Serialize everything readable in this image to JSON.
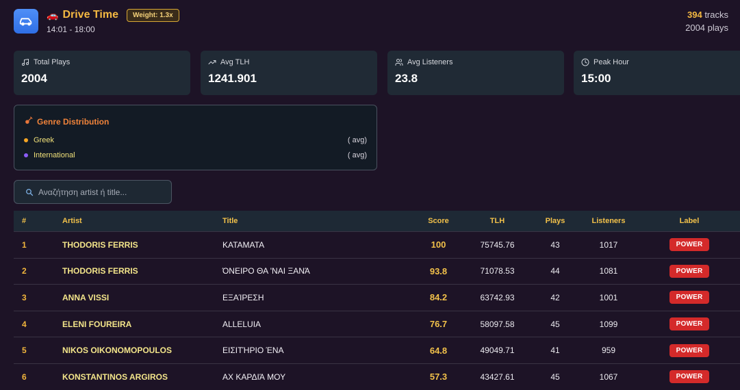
{
  "header": {
    "title": "Drive Time",
    "title_emoji": "🚗",
    "weight": "Weight: 1.3x",
    "time_range": "14:01 - 18:00",
    "tracks_number": "394",
    "tracks_suffix": " tracks",
    "plays": "2004 plays"
  },
  "stats": [
    {
      "label": "Total Plays",
      "value": "2004",
      "icon": "music-note-icon"
    },
    {
      "label": "Avg TLH",
      "value": "1241.901",
      "icon": "trending-up-icon"
    },
    {
      "label": "Avg Listeners",
      "value": "23.8",
      "icon": "users-icon"
    },
    {
      "label": "Peak Hour",
      "value": "15:00",
      "icon": "clock-icon"
    }
  ],
  "genre": {
    "title": "Genre Distribution",
    "icon": "guitar-icon",
    "items": [
      {
        "name": "Greek",
        "avg": "( avg)",
        "color": "#f5a524"
      },
      {
        "name": "International",
        "avg": "( avg)",
        "color": "#8b5cf6"
      }
    ]
  },
  "search": {
    "placeholder": "Αναζήτηση artist ή title..."
  },
  "table": {
    "headers": {
      "rank": "#",
      "artist": "Artist",
      "title": "Title",
      "score": "Score",
      "tlh": "TLH",
      "plays": "Plays",
      "listeners": "Listeners",
      "label": "Label"
    },
    "rows": [
      {
        "rank": "1",
        "artist": "THODORIS FERRIS",
        "title": "ΚΑΤΑΜΑΤΑ",
        "score": "100",
        "tlh": "75745.76",
        "plays": "43",
        "listeners": "1017",
        "label": "POWER"
      },
      {
        "rank": "2",
        "artist": "THODORIS FERRIS",
        "title": "ΌΝΕΙΡΟ ΘΑ 'ΝΑΙ ΞΑΝΆ",
        "score": "93.8",
        "tlh": "71078.53",
        "plays": "44",
        "listeners": "1081",
        "label": "POWER"
      },
      {
        "rank": "3",
        "artist": "ANNA VISSI",
        "title": "ΕΞΑΊΡΕΣΗ",
        "score": "84.2",
        "tlh": "63742.93",
        "plays": "42",
        "listeners": "1001",
        "label": "POWER"
      },
      {
        "rank": "4",
        "artist": "ELENI FOUREIRA",
        "title": "ALLELUIA",
        "score": "76.7",
        "tlh": "58097.58",
        "plays": "45",
        "listeners": "1099",
        "label": "POWER"
      },
      {
        "rank": "5",
        "artist": "NIKOS OIKONOMOPOULOS",
        "title": "ΕΙΣΙΤΉΡΙΟ ΈΝΑ",
        "score": "64.8",
        "tlh": "49049.71",
        "plays": "41",
        "listeners": "959",
        "label": "POWER"
      },
      {
        "rank": "6",
        "artist": "KONSTANTINOS ARGIROS",
        "title": "ΑΧ ΚΑΡΔΙΆ ΜΟΥ",
        "score": "57.3",
        "tlh": "43427.61",
        "plays": "45",
        "listeners": "1067",
        "label": "POWER"
      }
    ]
  },
  "colors": {
    "accent": "#f5b942",
    "power": "#d42a2a",
    "app_icon": "#3b82f6"
  }
}
